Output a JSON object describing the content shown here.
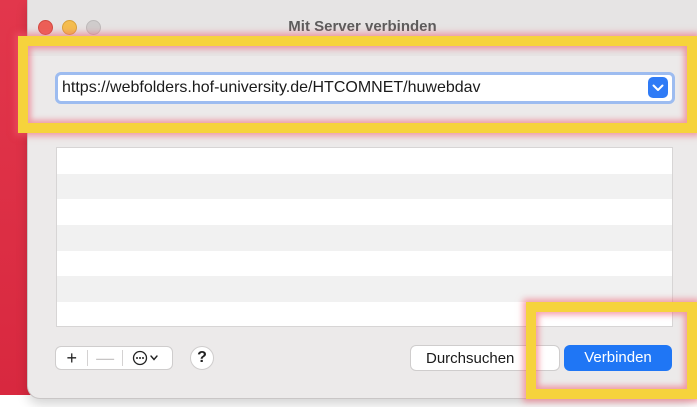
{
  "window": {
    "title": "Mit Server verbinden"
  },
  "server_address": {
    "value": "https://webfolders.hof-university.de/HTCOMNET/huwebdav",
    "dropdown_icon": "chevron-down-icon"
  },
  "favorites_list": {
    "row_count": 7
  },
  "toolbar": {
    "add_label": "+",
    "remove_label": "—",
    "more_icon": "ellipsis-circle-icon",
    "help_label": "?"
  },
  "buttons": {
    "browse_label": "Durchsuchen",
    "connect_label": "Verbinden"
  },
  "colors": {
    "accent": "#1f76f5",
    "highlight": "#f6d33c",
    "highlight_glow": "#f05a6e"
  }
}
